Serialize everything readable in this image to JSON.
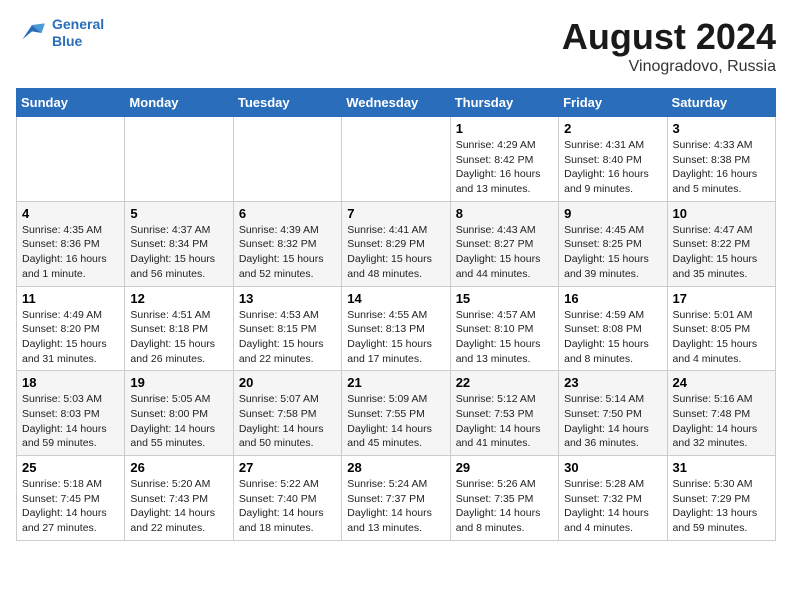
{
  "header": {
    "logo_line1": "General",
    "logo_line2": "Blue",
    "title": "August 2024",
    "location": "Vinogradovo, Russia"
  },
  "days_of_week": [
    "Sunday",
    "Monday",
    "Tuesday",
    "Wednesday",
    "Thursday",
    "Friday",
    "Saturday"
  ],
  "weeks": [
    [
      {
        "day": "",
        "info": ""
      },
      {
        "day": "",
        "info": ""
      },
      {
        "day": "",
        "info": ""
      },
      {
        "day": "",
        "info": ""
      },
      {
        "day": "1",
        "info": "Sunrise: 4:29 AM\nSunset: 8:42 PM\nDaylight: 16 hours\nand 13 minutes."
      },
      {
        "day": "2",
        "info": "Sunrise: 4:31 AM\nSunset: 8:40 PM\nDaylight: 16 hours\nand 9 minutes."
      },
      {
        "day": "3",
        "info": "Sunrise: 4:33 AM\nSunset: 8:38 PM\nDaylight: 16 hours\nand 5 minutes."
      }
    ],
    [
      {
        "day": "4",
        "info": "Sunrise: 4:35 AM\nSunset: 8:36 PM\nDaylight: 16 hours\nand 1 minute."
      },
      {
        "day": "5",
        "info": "Sunrise: 4:37 AM\nSunset: 8:34 PM\nDaylight: 15 hours\nand 56 minutes."
      },
      {
        "day": "6",
        "info": "Sunrise: 4:39 AM\nSunset: 8:32 PM\nDaylight: 15 hours\nand 52 minutes."
      },
      {
        "day": "7",
        "info": "Sunrise: 4:41 AM\nSunset: 8:29 PM\nDaylight: 15 hours\nand 48 minutes."
      },
      {
        "day": "8",
        "info": "Sunrise: 4:43 AM\nSunset: 8:27 PM\nDaylight: 15 hours\nand 44 minutes."
      },
      {
        "day": "9",
        "info": "Sunrise: 4:45 AM\nSunset: 8:25 PM\nDaylight: 15 hours\nand 39 minutes."
      },
      {
        "day": "10",
        "info": "Sunrise: 4:47 AM\nSunset: 8:22 PM\nDaylight: 15 hours\nand 35 minutes."
      }
    ],
    [
      {
        "day": "11",
        "info": "Sunrise: 4:49 AM\nSunset: 8:20 PM\nDaylight: 15 hours\nand 31 minutes."
      },
      {
        "day": "12",
        "info": "Sunrise: 4:51 AM\nSunset: 8:18 PM\nDaylight: 15 hours\nand 26 minutes."
      },
      {
        "day": "13",
        "info": "Sunrise: 4:53 AM\nSunset: 8:15 PM\nDaylight: 15 hours\nand 22 minutes."
      },
      {
        "day": "14",
        "info": "Sunrise: 4:55 AM\nSunset: 8:13 PM\nDaylight: 15 hours\nand 17 minutes."
      },
      {
        "day": "15",
        "info": "Sunrise: 4:57 AM\nSunset: 8:10 PM\nDaylight: 15 hours\nand 13 minutes."
      },
      {
        "day": "16",
        "info": "Sunrise: 4:59 AM\nSunset: 8:08 PM\nDaylight: 15 hours\nand 8 minutes."
      },
      {
        "day": "17",
        "info": "Sunrise: 5:01 AM\nSunset: 8:05 PM\nDaylight: 15 hours\nand 4 minutes."
      }
    ],
    [
      {
        "day": "18",
        "info": "Sunrise: 5:03 AM\nSunset: 8:03 PM\nDaylight: 14 hours\nand 59 minutes."
      },
      {
        "day": "19",
        "info": "Sunrise: 5:05 AM\nSunset: 8:00 PM\nDaylight: 14 hours\nand 55 minutes."
      },
      {
        "day": "20",
        "info": "Sunrise: 5:07 AM\nSunset: 7:58 PM\nDaylight: 14 hours\nand 50 minutes."
      },
      {
        "day": "21",
        "info": "Sunrise: 5:09 AM\nSunset: 7:55 PM\nDaylight: 14 hours\nand 45 minutes."
      },
      {
        "day": "22",
        "info": "Sunrise: 5:12 AM\nSunset: 7:53 PM\nDaylight: 14 hours\nand 41 minutes."
      },
      {
        "day": "23",
        "info": "Sunrise: 5:14 AM\nSunset: 7:50 PM\nDaylight: 14 hours\nand 36 minutes."
      },
      {
        "day": "24",
        "info": "Sunrise: 5:16 AM\nSunset: 7:48 PM\nDaylight: 14 hours\nand 32 minutes."
      }
    ],
    [
      {
        "day": "25",
        "info": "Sunrise: 5:18 AM\nSunset: 7:45 PM\nDaylight: 14 hours\nand 27 minutes."
      },
      {
        "day": "26",
        "info": "Sunrise: 5:20 AM\nSunset: 7:43 PM\nDaylight: 14 hours\nand 22 minutes."
      },
      {
        "day": "27",
        "info": "Sunrise: 5:22 AM\nSunset: 7:40 PM\nDaylight: 14 hours\nand 18 minutes."
      },
      {
        "day": "28",
        "info": "Sunrise: 5:24 AM\nSunset: 7:37 PM\nDaylight: 14 hours\nand 13 minutes."
      },
      {
        "day": "29",
        "info": "Sunrise: 5:26 AM\nSunset: 7:35 PM\nDaylight: 14 hours\nand 8 minutes."
      },
      {
        "day": "30",
        "info": "Sunrise: 5:28 AM\nSunset: 7:32 PM\nDaylight: 14 hours\nand 4 minutes."
      },
      {
        "day": "31",
        "info": "Sunrise: 5:30 AM\nSunset: 7:29 PM\nDaylight: 13 hours\nand 59 minutes."
      }
    ]
  ]
}
